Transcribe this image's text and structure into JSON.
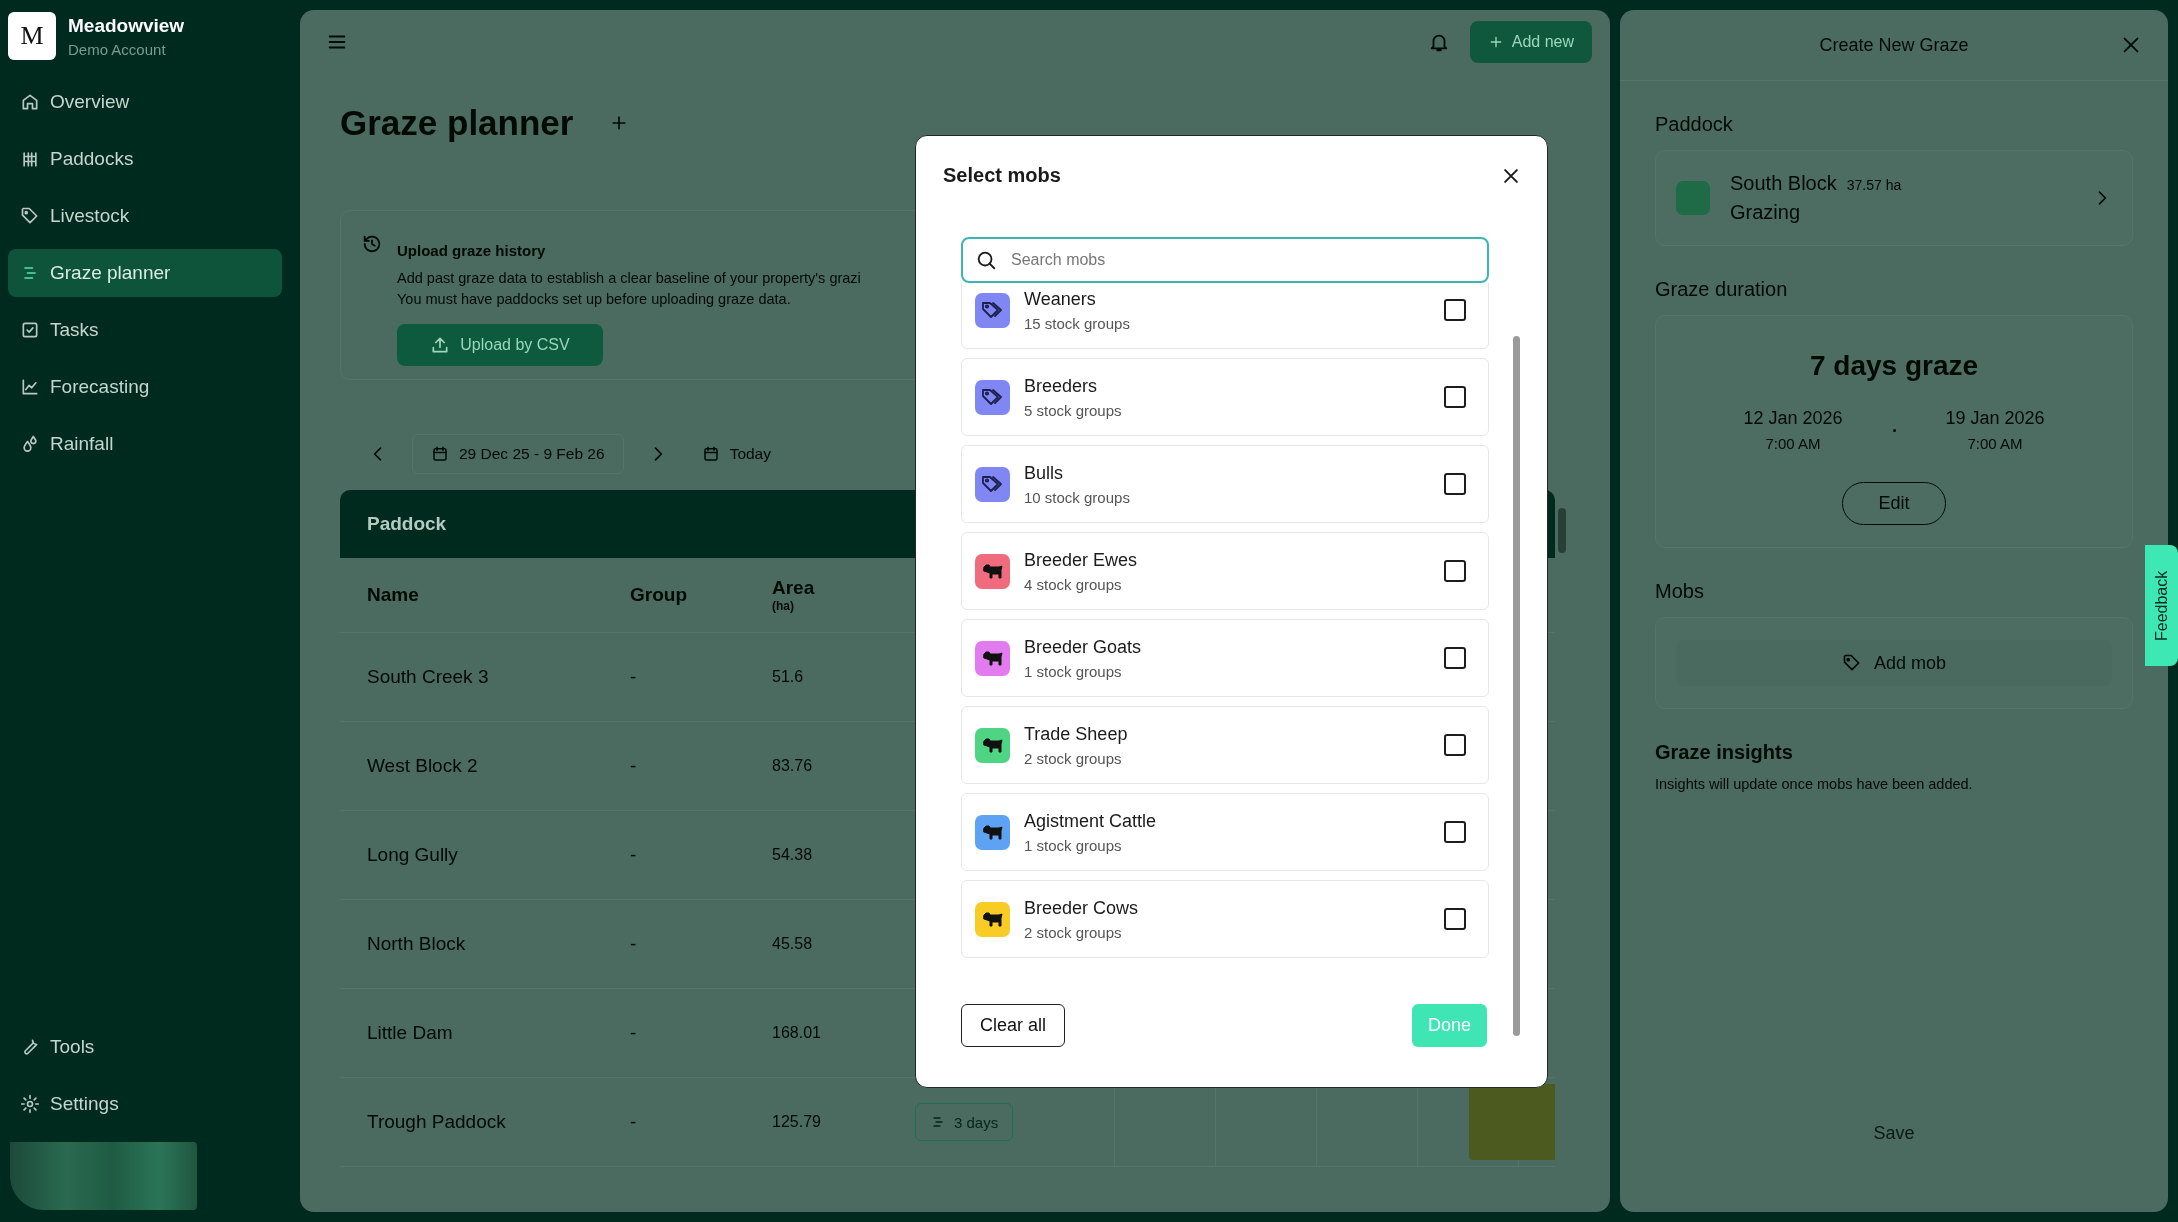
{
  "sidebar": {
    "account": {
      "initial": "M",
      "name": "Meadowview",
      "subtitle": "Demo Account"
    },
    "items": [
      {
        "label": "Overview",
        "selected": false
      },
      {
        "label": "Paddocks",
        "selected": false
      },
      {
        "label": "Livestock",
        "selected": false
      },
      {
        "label": "Graze planner",
        "selected": true
      },
      {
        "label": "Tasks",
        "selected": false
      },
      {
        "label": "Forecasting",
        "selected": false
      },
      {
        "label": "Rainfall",
        "selected": false
      }
    ],
    "footer_items": [
      {
        "label": "Tools",
        "selected": false
      },
      {
        "label": "Settings",
        "selected": false
      }
    ]
  },
  "planner": {
    "add_new": "Add new",
    "title": "Graze planner",
    "upload": {
      "title": "Upload graze history",
      "lines": [
        "Add past graze data to establish a clear baseline of your property's grazi",
        "You must have paddocks set up before uploading graze data."
      ],
      "button": "Upload by CSV"
    },
    "date_range": "29 Dec 25 - 9 Feb 26",
    "today": "Today",
    "table": {
      "group_title": "Paddock",
      "columns": [
        {
          "label": "Name"
        },
        {
          "label": "Group"
        },
        {
          "label": "Area",
          "unit": "(ha)"
        }
      ],
      "rows": [
        {
          "name": "South Creek 3",
          "group": "-",
          "area": "51.6",
          "graze_bar": false
        },
        {
          "name": "West Block 2",
          "group": "-",
          "area": "83.76",
          "graze_bar": false
        },
        {
          "name": "Long Gully",
          "group": "-",
          "area": "54.38",
          "graze_bar": false
        },
        {
          "name": "North Block",
          "group": "-",
          "area": "45.58",
          "graze_bar": false
        },
        {
          "name": "Little Dam",
          "group": "-",
          "area": "168.01",
          "graze_bar": false
        },
        {
          "name": "Trough Paddock",
          "group": "-",
          "area": "125.79",
          "badge": "3 days",
          "graze_bar": true
        }
      ]
    }
  },
  "graze_panel": {
    "title": "Create New Graze",
    "paddock_label": "Paddock",
    "paddock": {
      "name": "South Block",
      "area": "37.57 ha",
      "status": "Grazing"
    },
    "duration_label": "Graze duration",
    "duration": "7 days graze",
    "start": {
      "date": "12 Jan 2026",
      "time": "7:00 AM"
    },
    "end": {
      "date": "19 Jan 2026",
      "time": "7:00 AM"
    },
    "edit": "Edit",
    "mobs_label": "Mobs",
    "add_mob": "Add mob",
    "insights_label": "Graze insights",
    "insights_note": "Insights will update once mobs have been added.",
    "save": "Save",
    "feedback": "Feedback"
  },
  "mob_dialog": {
    "title": "Select mobs",
    "search": {
      "placeholder": "Search mobs"
    },
    "mobs": [
      {
        "name": "Weaners",
        "count": "15 stock groups",
        "kind": "tag",
        "color": "#8086f2",
        "checked": false
      },
      {
        "name": "Breeders",
        "count": "5 stock groups",
        "kind": "tag",
        "color": "#8086f2",
        "checked": false
      },
      {
        "name": "Bulls",
        "count": "10 stock groups",
        "kind": "tag",
        "color": "#8086f2",
        "checked": false
      },
      {
        "name": "Breeder Ewes",
        "count": "4 stock groups",
        "kind": "animal",
        "color": "#f16b7f",
        "checked": false
      },
      {
        "name": "Breeder Goats",
        "count": "1 stock groups",
        "kind": "animal",
        "color": "#e27bf0",
        "checked": false
      },
      {
        "name": "Trade Sheep",
        "count": "2 stock groups",
        "kind": "animal",
        "color": "#4ed483",
        "checked": false
      },
      {
        "name": "Agistment Cattle",
        "count": "1 stock groups",
        "kind": "animal",
        "color": "#5ea2f3",
        "checked": false
      },
      {
        "name": "Breeder Cows",
        "count": "2 stock groups",
        "kind": "animal",
        "color": "#f8cc25",
        "checked": false
      }
    ],
    "clear": "Clear all",
    "done": "Done"
  }
}
